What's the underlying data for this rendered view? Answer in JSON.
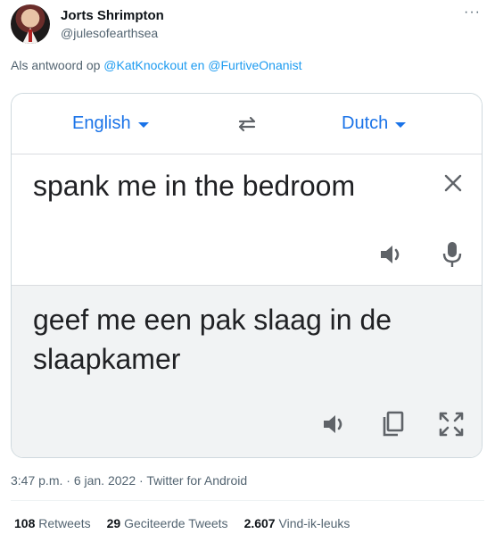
{
  "tweet": {
    "author_name": "Jorts Shrimpton",
    "author_handle": "@julesofearthsea",
    "more_label": "···",
    "reply_prefix": "Als antwoord op",
    "reply_user_1": "@KatKnockout",
    "reply_conjunction": "en",
    "reply_user_2": "@FurtiveOnanist",
    "time": "3:47 p.m.",
    "date": "6 jan. 2022",
    "source": "Twitter for Android",
    "sep": "·"
  },
  "translate": {
    "source_language": "English",
    "target_language": "Dutch",
    "source_text": "spank me in the bedroom",
    "translated_text": "geef me een pak slaag in de slaapkamer",
    "icons": [
      "swap-icon",
      "close-icon",
      "speaker-icon",
      "microphone-icon",
      "copy-icon",
      "fullscreen-icon"
    ],
    "colors": {
      "accent": "#1a73e8",
      "icon": "#5f6368",
      "output_bg": "#f1f3f4"
    }
  },
  "stats": {
    "retweets_count": "108",
    "retweets_label": "Retweets",
    "quotes_count": "29",
    "quotes_label": "Geciteerde Tweets",
    "likes_count": "2.607",
    "likes_label": "Vind-ik-leuks"
  }
}
